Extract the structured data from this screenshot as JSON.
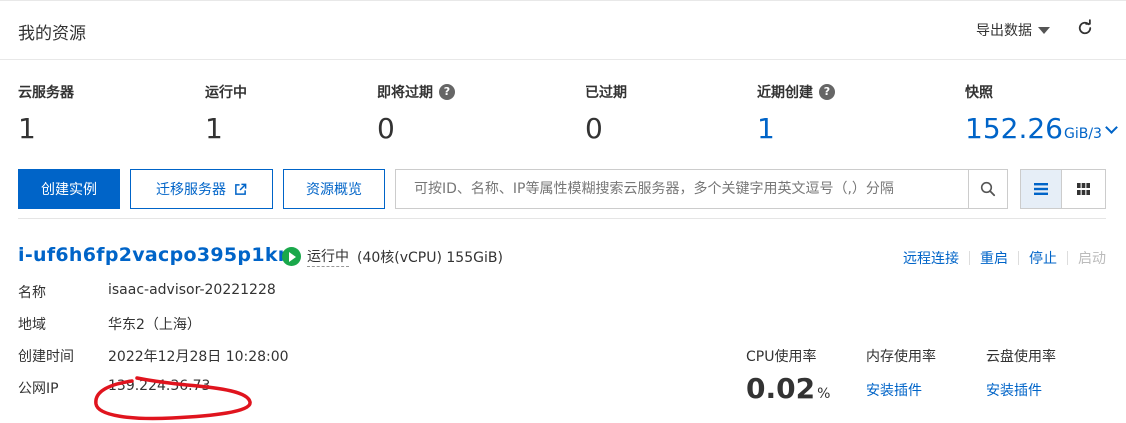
{
  "header": {
    "title": "我的资源",
    "export_label": "导出数据"
  },
  "stats": [
    {
      "label": "云服务器",
      "value": "1"
    },
    {
      "label": "运行中",
      "value": "1"
    },
    {
      "label": "即将过期",
      "value": "0",
      "help": "?"
    },
    {
      "label": "已过期",
      "value": "0"
    },
    {
      "label": "近期创建",
      "value": "1",
      "help": "?"
    },
    {
      "label": "快照",
      "value": "152.26",
      "unit": "GiB/3"
    }
  ],
  "toolbar": {
    "create_label": "创建实例",
    "migrate_label": "迁移服务器",
    "overview_label": "资源概览",
    "search_placeholder": "可按ID、名称、IP等属性模糊搜索云服务器，多个关键字用英文逗号（,）分隔"
  },
  "instance": {
    "id": "i-uf6h6fp2vacpo395p1kr",
    "status": "运行中",
    "spec": "(40核(vCPU) 155GiB)",
    "actions": [
      "远程连接",
      "重启",
      "停止",
      "启动"
    ],
    "fields": [
      {
        "label": "名称",
        "value": "isaac-advisor-20221228"
      },
      {
        "label": "地域",
        "value": "华东2（上海）"
      },
      {
        "label": "创建时间",
        "value": "2022年12月28日 10:28:00"
      },
      {
        "label": "公网IP",
        "value": "139.224.36.73"
      }
    ],
    "metrics": {
      "cpu_label": "CPU使用率",
      "cpu_value": "0.02",
      "cpu_unit": "%",
      "mem_label": "内存使用率",
      "mem_link": "安装插件",
      "disk_label": "云盘使用率",
      "disk_link": "安装插件"
    }
  },
  "colors": {
    "accent": "#0064c8",
    "running": "#1aa84b",
    "annotation": "#e0141e"
  }
}
